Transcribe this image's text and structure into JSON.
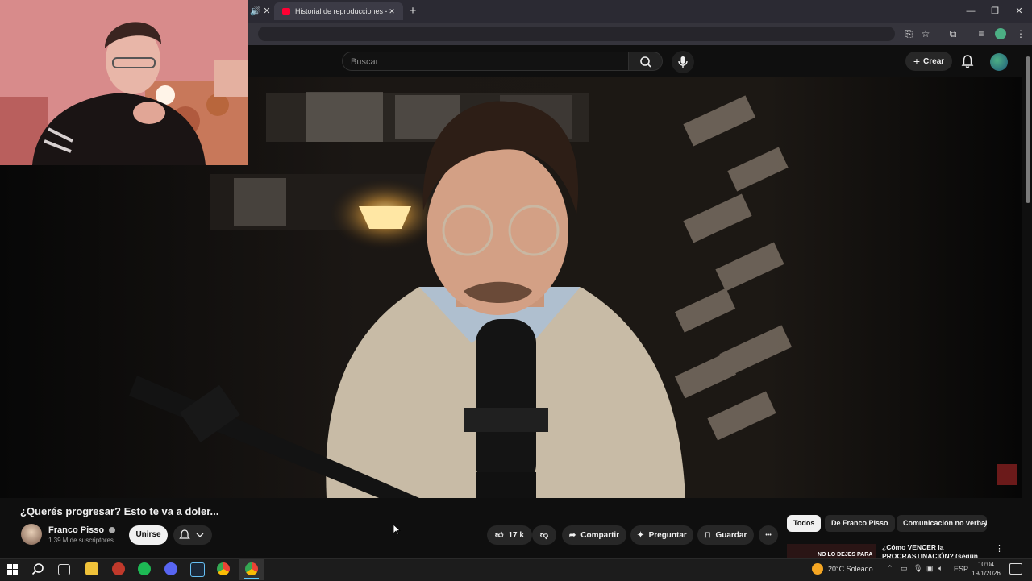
{
  "browser": {
    "tab_title": "Historial de reproducciones - YouTube",
    "tab_close": "✕",
    "new_tab": "+",
    "window_controls": [
      "—",
      "❐",
      "✕"
    ]
  },
  "youtube": {
    "search_placeholder": "Buscar",
    "create_label": "Crear"
  },
  "video": {
    "title": "¿Querés progresar? Esto te va a doler...",
    "channel_name": "Franco Pisso",
    "subscribers": "1.39 M de suscriptores",
    "join_label": "Unirse",
    "likes": "17 k",
    "share_label": "Compartir",
    "ask_label": "Preguntar",
    "save_label": "Guardar",
    "more_label": "•••"
  },
  "chips": [
    "Todos",
    "De Franco Pisso",
    "Comunicación no verbal"
  ],
  "recommendation": {
    "title": "¿Cómo VENCER la PROCRASTINACIÓN? (según l...",
    "thumb_text": "NO LO DEJES PARA"
  },
  "taskbar": {
    "weather": "20°C  Soleado",
    "language": "ESP",
    "time": "10:04",
    "date": "19/1/2026"
  }
}
